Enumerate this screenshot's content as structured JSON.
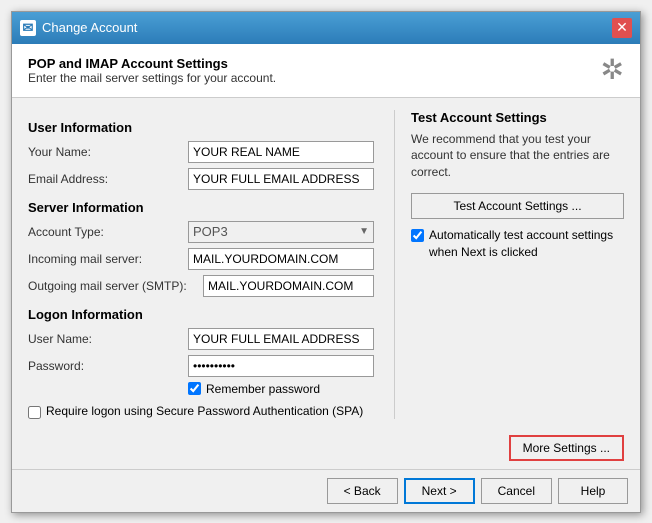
{
  "titlebar": {
    "icon_label": "✉",
    "title": "Change Account",
    "close_label": "✕"
  },
  "header": {
    "title": "POP and IMAP Account Settings",
    "subtitle": "Enter the mail server settings for your account.",
    "icon": "✲"
  },
  "left_panel": {
    "user_info_title": "User Information",
    "your_name_label": "Your Name:",
    "your_name_value": "YOUR REAL NAME",
    "email_label": "Email Address:",
    "email_value": "YOUR FULL EMAIL ADDRESS",
    "server_info_title": "Server Information",
    "account_type_label": "Account Type:",
    "account_type_value": "POP3",
    "incoming_label": "Incoming mail server:",
    "incoming_value": "MAIL.YOURDOMAIN.COM",
    "outgoing_label": "Outgoing mail server (SMTP):",
    "outgoing_value": "MAIL.YOURDOMAIN.COM",
    "logon_info_title": "Logon Information",
    "username_label": "User Name:",
    "username_value": "YOUR FULL EMAIL ADDRESS",
    "password_label": "Password:",
    "password_value": "**********",
    "remember_password_label": "Remember password",
    "spa_label": "Require logon using Secure Password Authentication (SPA)"
  },
  "right_panel": {
    "title": "Test Account Settings",
    "description": "We recommend that you test your account to ensure that the entries are correct.",
    "test_btn_label": "Test Account Settings ...",
    "auto_check_label": "Automatically test account settings when Next is clicked"
  },
  "more_settings_btn": "More Settings ...",
  "footer": {
    "back_label": "< Back",
    "next_label": "Next >",
    "cancel_label": "Cancel",
    "help_label": "Help"
  }
}
